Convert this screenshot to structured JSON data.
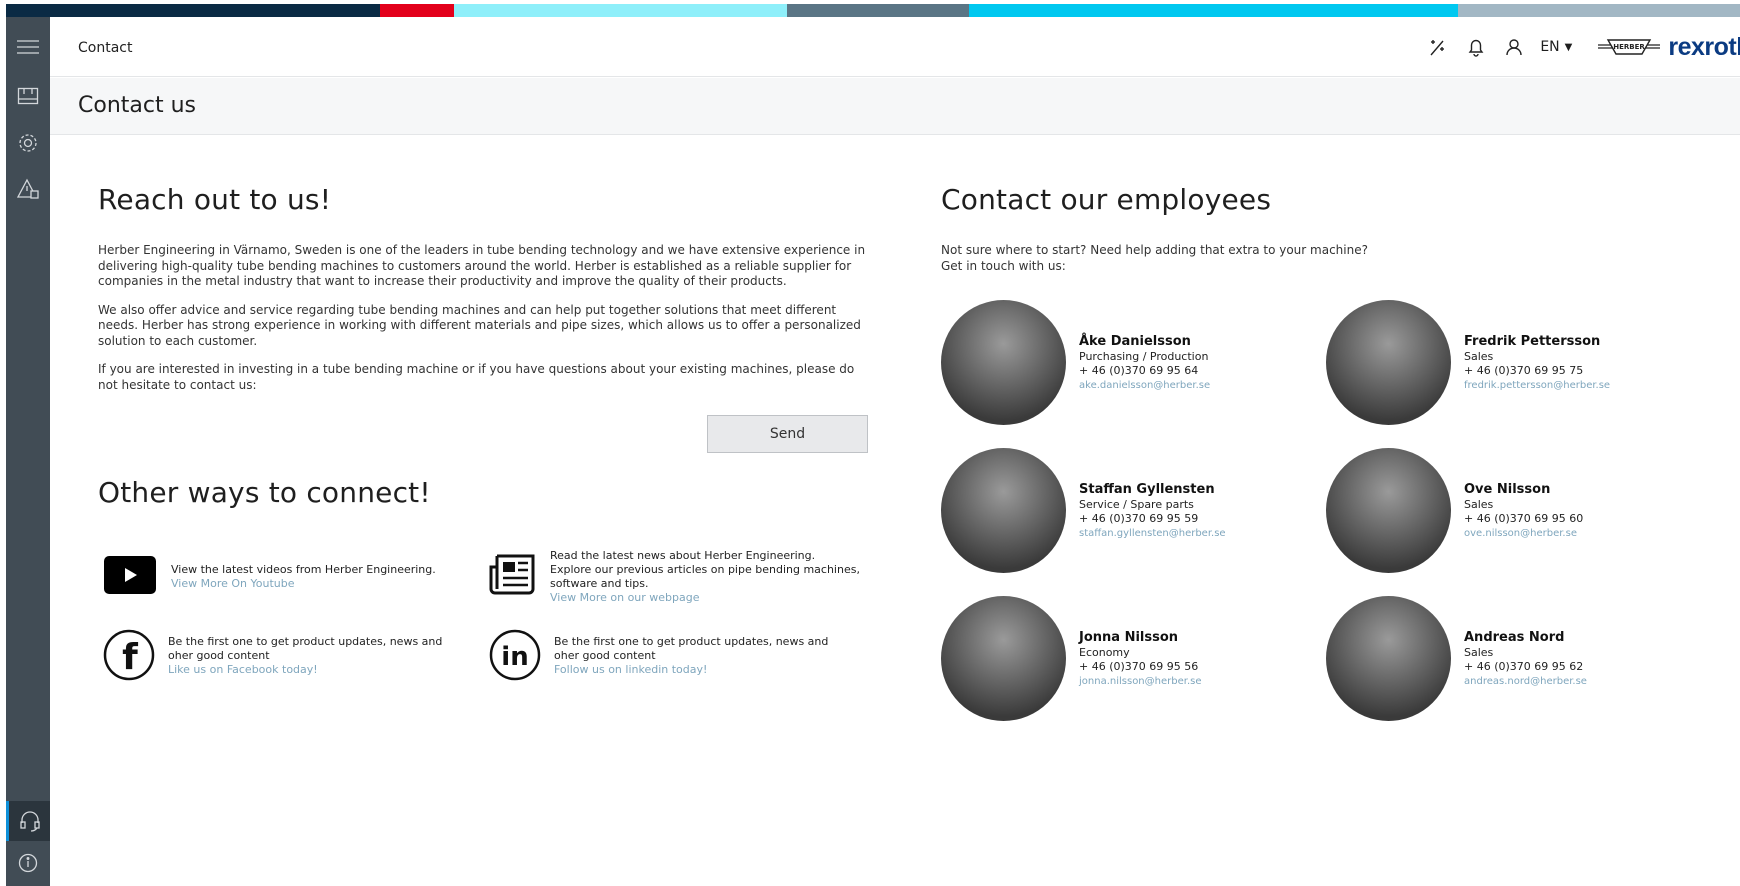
{
  "header": {
    "breadcrumb": "Contact",
    "language": "EN",
    "brand_partner": "HERBER",
    "brand": "rexroth"
  },
  "page": {
    "title": "Contact us"
  },
  "reach": {
    "heading": "Reach out to us!",
    "p1": "Herber Engineering in Värnamo, Sweden is one of the leaders in tube bending technology and we have extensive experience in delivering high-quality tube bending machines to customers around the world. Herber is established as a reliable supplier for companies in the metal industry that want to increase their productivity and improve the quality of their products.",
    "p2": "We also offer advice and service regarding tube bending machines and can help put together solutions that meet different needs. Herber has strong experience in working with different materials and pipe sizes, which allows us to offer a personalized solution to each customer.",
    "p3": "If you are interested in investing in a tube bending machine or if you have questions about your existing machines, please do not hesitate to contact us:",
    "send": "Send"
  },
  "other": {
    "heading": "Other ways to connect!",
    "youtube": {
      "text": "View the latest videos from Herber Engineering.",
      "link": "View More On Youtube"
    },
    "news": {
      "text1": "Read the latest news about Herber Engineering.",
      "text2": "Explore our previous articles on pipe bending machines, software and tips.",
      "link": "View More on our webpage"
    },
    "facebook": {
      "text": "Be the first one to get product updates, news and oher good content",
      "link": "Like us on Facebook today!"
    },
    "linkedin": {
      "text": "Be the first one to get product updates, news and oher good content",
      "link": "Follow us on linkedin today!"
    }
  },
  "employees": {
    "heading": "Contact our employees",
    "intro1": "Not sure where to start? Need help adding that extra to your machine?",
    "intro2": "Get in touch with us:",
    "list": [
      {
        "name": "Åke Danielsson",
        "role": "Purchasing / Production",
        "phone": "+ 46 (0)370 69 95 64",
        "email": "ake.danielsson@herber.se"
      },
      {
        "name": "Fredrik Pettersson",
        "role": "Sales",
        "phone": "+ 46 (0)370 69 95 75",
        "email": "fredrik.pettersson@herber.se"
      },
      {
        "name": "Staffan Gyllensten",
        "role": "Service / Spare parts",
        "phone": "+ 46 (0)370 69 95 59",
        "email": "staffan.gyllensten@herber.se"
      },
      {
        "name": "Ove Nilsson",
        "role": "Sales",
        "phone": "+ 46 (0)370 69 95 60",
        "email": "ove.nilsson@herber.se"
      },
      {
        "name": "Jonna Nilsson",
        "role": "Economy",
        "phone": "+ 46 (0)370 69 95 56",
        "email": "jonna.nilsson@herber.se"
      },
      {
        "name": "Andreas Nord",
        "role": "Sales",
        "phone": "+ 46 (0)370 69 95 62",
        "email": "andreas.nord@herber.se"
      }
    ]
  },
  "colors": {
    "stripe": [
      "#0a2a44",
      "#e3001b",
      "#8eeffa",
      "#5a7585",
      "#00c8f0",
      "#a2b7c4"
    ],
    "sidebar": "#414c55",
    "link": "#7fa6bd"
  }
}
